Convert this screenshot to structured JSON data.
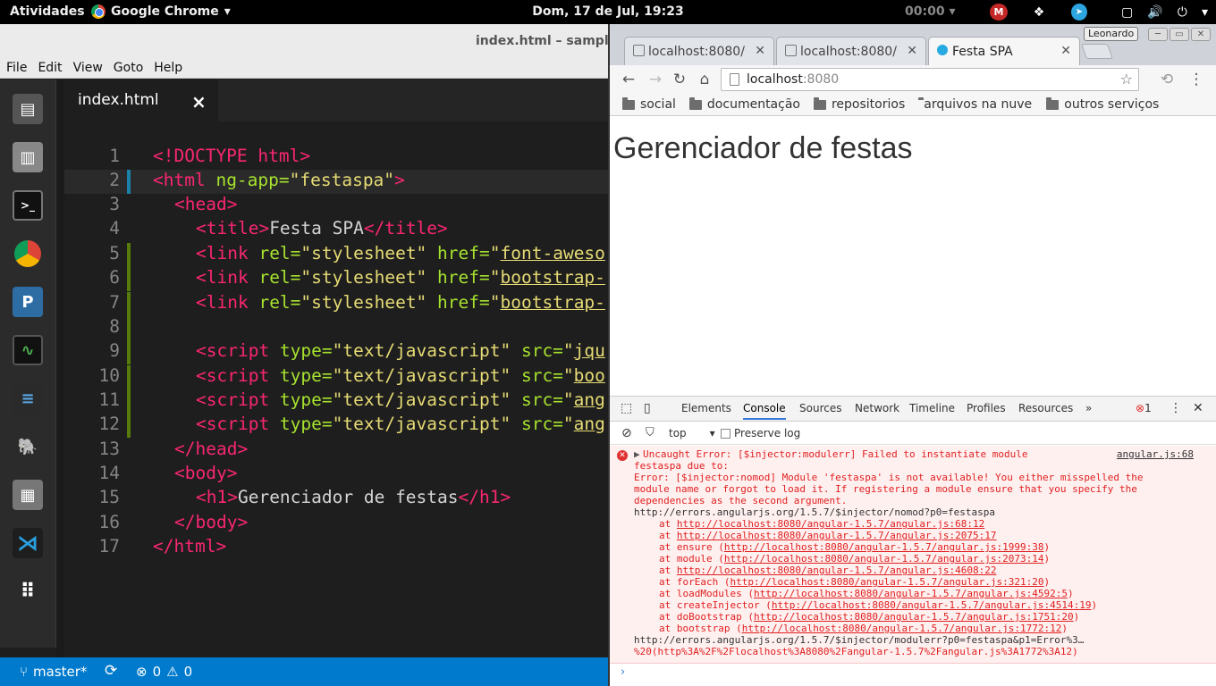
{
  "topbar": {
    "activities": "Atividades",
    "app": "Google Chrome",
    "clock": "Dom, 17 de Jul, 19:23",
    "timer": "00:00"
  },
  "editor": {
    "window_title": "index.html – samplesp",
    "menu": [
      "File",
      "Edit",
      "View",
      "Goto",
      "Help"
    ],
    "tab_name": "index.html",
    "line_numbers": [
      "1",
      "2",
      "3",
      "4",
      "5",
      "6",
      "7",
      "8",
      "9",
      "10",
      "11",
      "12",
      "13",
      "14",
      "15",
      "16",
      "17"
    ],
    "code": {
      "l1": "<!DOCTYPE html>",
      "l2_tag": "<html ",
      "l2_attr": "ng-app=",
      "l2_val": "\"festaspa\"",
      "l2_end": ">",
      "l3": "<head>",
      "l4_open": "<title>",
      "l4_text": "Festa SPA",
      "l4_close": "</title>",
      "link_tag": "<link ",
      "rel_attr": "rel=",
      "rel_val": "\"stylesheet\"",
      "href_attr": " href=",
      "quote": "\"",
      "l5_href": "font-aweso",
      "l6_href": "bootstrap-",
      "l7_href": "bootstrap-",
      "script_tag": "<script ",
      "type_attr": "type=",
      "type_val": "\"text/javascript\"",
      "src_attr": " src=",
      "l9_src": "jqu",
      "l10_src": "boo",
      "l11_src": "ang",
      "l12_src": "ang",
      "l13": "</head>",
      "l14": "<body>",
      "l15_open": "<h1>",
      "l15_text": "Gerenciador de festas",
      "l15_close": "</h1>",
      "l16": "</body>",
      "l17": "</html>"
    },
    "status": {
      "branch": "master*",
      "errors": "0",
      "warnings": "0"
    }
  },
  "browser": {
    "user": "Leonardo",
    "tabs": [
      {
        "label": "localhost:8080/"
      },
      {
        "label": "localhost:8080/"
      },
      {
        "label": "Festa SPA"
      }
    ],
    "url_host": "localhost",
    "url_port": ":8080",
    "bookmarks": [
      "social",
      "documentação",
      "repositorios",
      "arquivos na nuvem",
      "outros serviços"
    ],
    "page_heading": "Gerenciador de festas"
  },
  "devtools": {
    "tabs": [
      "Elements",
      "Console",
      "Sources",
      "Network",
      "Timeline",
      "Profiles",
      "Resources"
    ],
    "active_tab": "Console",
    "error_count": "1",
    "context": "top",
    "preserve_log": "Preserve log",
    "source_link": "angular.js:68",
    "lines": [
      "Uncaught Error: [$injector:modulerr] Failed to instantiate module",
      "festaspa due to:",
      "Error: [$injector:nomod] Module 'festaspa' is not available! You either misspelled the",
      "module name or forgot to load it. If registering a module ensure that you specify the",
      "dependencies as the second argument.",
      "http://errors.angularjs.org/1.5.7/$injector/nomod?p0=festaspa"
    ],
    "stack": [
      {
        "fn": "",
        "url": "http://localhost:8080/angular-1.5.7/angular.js:68:12"
      },
      {
        "fn": "",
        "url": "http://localhost:8080/angular-1.5.7/angular.js:2075:17"
      },
      {
        "fn": "ensure ",
        "url": "http://localhost:8080/angular-1.5.7/angular.js:1999:38"
      },
      {
        "fn": "module ",
        "url": "http://localhost:8080/angular-1.5.7/angular.js:2073:14"
      },
      {
        "fn": "",
        "url": "http://localhost:8080/angular-1.5.7/angular.js:4608:22"
      },
      {
        "fn": "forEach ",
        "url": "http://localhost:8080/angular-1.5.7/angular.js:321:20"
      },
      {
        "fn": "loadModules ",
        "url": "http://localhost:8080/angular-1.5.7/angular.js:4592:5"
      },
      {
        "fn": "createInjector ",
        "url": "http://localhost:8080/angular-1.5.7/angular.js:4514:19"
      },
      {
        "fn": "doBootstrap ",
        "url": "http://localhost:8080/angular-1.5.7/angular.js:1751:20"
      },
      {
        "fn": "bootstrap ",
        "url": "http://localhost:8080/angular-1.5.7/angular.js:1772:12"
      }
    ],
    "tail": [
      "http://errors.angularjs.org/1.5.7/$injector/modulerr?p0=festaspa&p1=Error%3…",
      "%20(http%3A%2F%2Flocalhost%3A8080%2Fangular-1.5.7%2Fangular.js%3A1772%3A12)"
    ],
    "prompt": "›"
  },
  "colors": {
    "status_bar": "#007acc",
    "tag": "#f92672",
    "attr": "#a6e22e",
    "string": "#e6db74",
    "error_text": "#e02020"
  }
}
